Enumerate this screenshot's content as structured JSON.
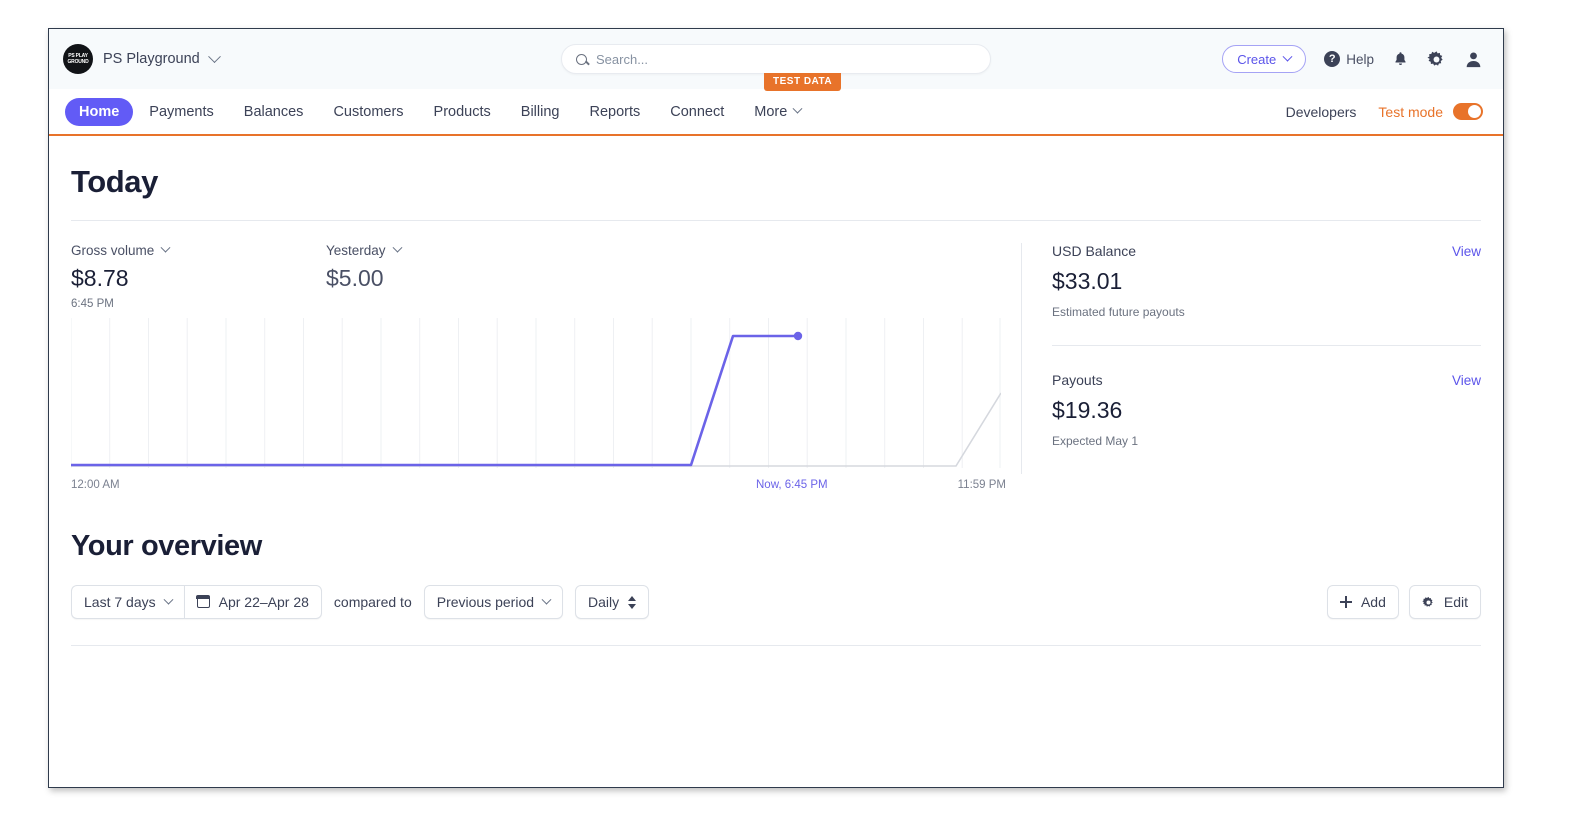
{
  "header": {
    "logo_icon": "stripe-avatar-icon",
    "account_name": "PS Playground",
    "account_chevron_icon": "chevron-down-icon",
    "search": {
      "placeholder": "Search...",
      "value": "",
      "icon": "search-icon"
    },
    "create_button": "Create",
    "create_chevron_icon": "chevron-down-icon",
    "help_button": "Help",
    "help_icon": "question-circle-icon",
    "notifications_icon": "bell-icon",
    "settings_icon": "gear-icon",
    "account_icon": "person-icon"
  },
  "nav": {
    "items": [
      {
        "label": "Home",
        "active": true
      },
      {
        "label": "Payments",
        "active": false
      },
      {
        "label": "Balances",
        "active": false
      },
      {
        "label": "Customers",
        "active": false
      },
      {
        "label": "Products",
        "active": false
      },
      {
        "label": "Billing",
        "active": false
      },
      {
        "label": "Reports",
        "active": false
      },
      {
        "label": "Connect",
        "active": false
      },
      {
        "label": "More",
        "active": false,
        "chevron_icon": "chevron-down-icon"
      }
    ],
    "developers_label": "Developers",
    "test_mode_label": "Test mode",
    "test_mode_on": true,
    "test_data_badge": "TEST DATA",
    "accent_color": "#e8732a",
    "active_color": "#625bf6"
  },
  "today": {
    "title": "Today",
    "metrics": [
      {
        "label": "Gross volume",
        "chevron_icon": "chevron-down-icon",
        "value": "$8.78",
        "sub": "6:45 PM"
      },
      {
        "label": "Yesterday",
        "chevron_icon": "chevron-down-icon",
        "value": "$5.00",
        "sub": ""
      }
    ]
  },
  "chart_data": {
    "type": "line",
    "title": "Gross volume",
    "xlabel": "",
    "ylabel": "",
    "x_tick_labels": [
      "12:00 AM",
      "Now, 6:45 PM",
      "11:59 PM"
    ],
    "x_axis_start": "12:00 AM",
    "x_axis_end": "11:59 PM",
    "gridlines": 24,
    "grid": true,
    "legend": "none",
    "ylim": [
      0,
      10
    ],
    "series": [
      {
        "name": "Today",
        "color": "#6b63e8",
        "has_end_marker": true,
        "points": [
          {
            "x": "12:00 AM",
            "y": 0
          },
          {
            "x": "5:00 PM",
            "y": 0
          },
          {
            "x": "6:00 PM",
            "y": 8.78
          },
          {
            "x": "6:45 PM",
            "y": 8.78
          }
        ]
      },
      {
        "name": "Yesterday",
        "color": "#d5d8de",
        "has_end_marker": false,
        "points": [
          {
            "x": "12:00 AM",
            "y": 0
          },
          {
            "x": "10:45 PM",
            "y": 0
          },
          {
            "x": "11:59 PM",
            "y": 5.0
          }
        ]
      }
    ]
  },
  "balances": [
    {
      "title": "USD Balance",
      "view_label": "View",
      "amount": "$33.01",
      "sub": "Estimated future payouts"
    },
    {
      "title": "Payouts",
      "view_label": "View",
      "amount": "$19.36",
      "sub": "Expected May 1"
    }
  ],
  "overview": {
    "title": "Your overview",
    "range_select": "Last 7 days",
    "range_chevron_icon": "chevron-down-icon",
    "date_range": "Apr 22–Apr 28",
    "calendar_icon": "calendar-icon",
    "compared_to_label": "compared to",
    "compare_select": "Previous period",
    "compare_chevron_icon": "chevron-down-icon",
    "interval_select": "Daily",
    "interval_icon": "up-down-chevron-icon",
    "add_button": "Add",
    "add_icon": "plus-icon",
    "edit_button": "Edit",
    "edit_icon": "gear-icon"
  }
}
